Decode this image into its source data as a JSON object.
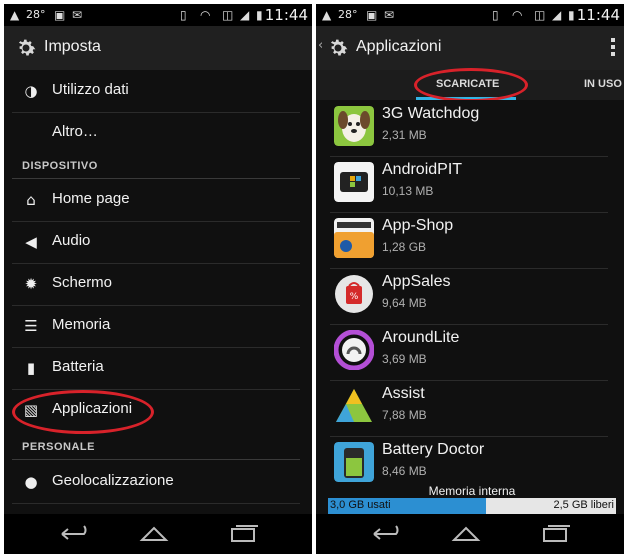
{
  "left": {
    "status": {
      "temp": "28°",
      "time": "11:44"
    },
    "title": "Imposta",
    "items_top": [
      {
        "label": "Utilizzo dati",
        "icon": "data-usage-icon"
      },
      {
        "label": "Altro…",
        "icon": ""
      }
    ],
    "section_dispositivo": "DISPOSITIVO",
    "items_device": [
      {
        "label": "Home page",
        "icon": "home-icon"
      },
      {
        "label": "Audio",
        "icon": "volume-icon"
      },
      {
        "label": "Schermo",
        "icon": "brightness-icon"
      },
      {
        "label": "Memoria",
        "icon": "storage-icon"
      },
      {
        "label": "Batteria",
        "icon": "battery-icon"
      },
      {
        "label": "Applicazioni",
        "icon": "apps-icon"
      }
    ],
    "section_personale": "PERSONALE",
    "items_personal": [
      {
        "label": "Geolocalizzazione",
        "icon": "location-icon"
      }
    ]
  },
  "right": {
    "status": {
      "temp": "28°",
      "time": "11:44"
    },
    "title": "Applicazioni",
    "tabs": [
      {
        "label": "SCARICATE",
        "active": true
      },
      {
        "label": "IN USO",
        "active": false
      }
    ],
    "apps": [
      {
        "name": "3G Watchdog",
        "size": "2,31 MB",
        "icon": "watchdog-icon"
      },
      {
        "name": "AndroidPIT",
        "size": "10,13 MB",
        "icon": "androidpit-icon"
      },
      {
        "name": "App-Shop",
        "size": "1,28 GB",
        "icon": "amazon-apps-icon"
      },
      {
        "name": "AppSales",
        "size": "9,64 MB",
        "icon": "appsales-icon"
      },
      {
        "name": "AroundLite",
        "size": "3,69 MB",
        "icon": "aroundlite-icon"
      },
      {
        "name": "Assist",
        "size": "7,88 MB",
        "icon": "assist-icon"
      },
      {
        "name": "Battery Doctor",
        "size": "8,46 MB",
        "icon": "battery-doctor-icon"
      }
    ],
    "storage": {
      "label": "Memoria interna",
      "used": "3,0 GB usati",
      "free": "2,5 GB liberi",
      "used_fraction": 0.55
    }
  },
  "colors": {
    "highlight_circle": "#d8222a",
    "accent": "#33b5e5"
  }
}
